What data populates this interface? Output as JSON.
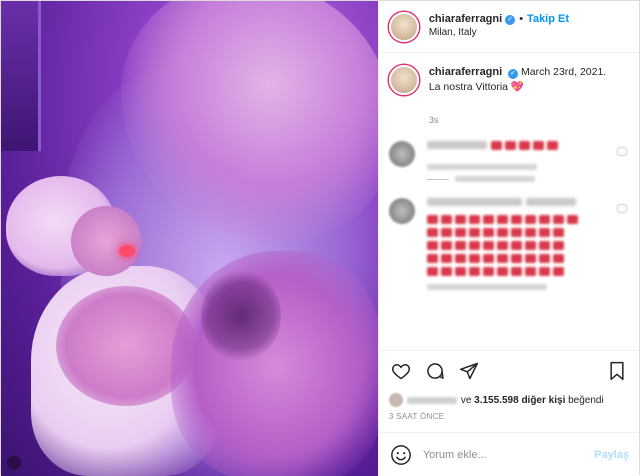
{
  "header": {
    "username": "chiaraferragni",
    "follow_label": "Takip Et",
    "separator": "•",
    "location": "Milan, Italy"
  },
  "caption": {
    "username": "chiaraferragni",
    "date": "March 23rd, 2021.",
    "text": "La nostra Vittoria",
    "emoji": "💖",
    "time": "3s"
  },
  "likes": {
    "joiner": "ve",
    "count": "3.155.598",
    "suffix": "diğer kişi",
    "action": "beğendi"
  },
  "timestamp": "3 SAAT ÖNCE",
  "comment_box": {
    "placeholder": "Yorum ekle...",
    "submit_label": "Paylaş"
  },
  "colors": {
    "link_blue": "#0095f6",
    "verified_blue": "#3897f0",
    "heart_red": "#d9384a",
    "photo_purple": "#8a3fc4"
  },
  "icons": {
    "like": "heart-outline-icon",
    "comment": "speech-bubble-icon",
    "share": "paper-plane-icon",
    "save": "bookmark-icon",
    "emoji": "smiley-icon",
    "verified": "verified-badge-icon"
  }
}
